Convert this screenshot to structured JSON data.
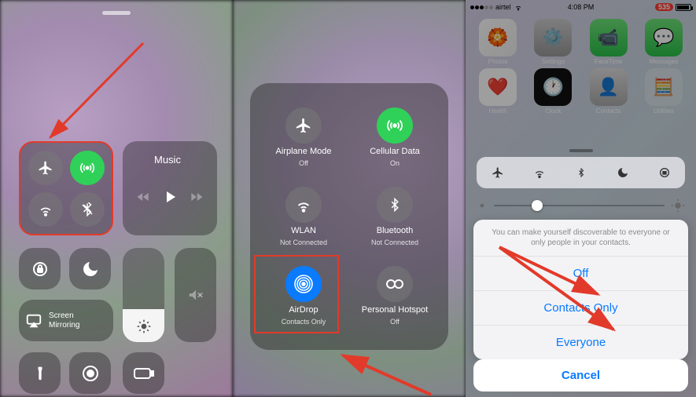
{
  "panel1": {
    "music_title": "Music",
    "mirror_label": "Screen\nMirroring"
  },
  "panel2": {
    "items": [
      {
        "label": "Airplane Mode",
        "sub": "Off"
      },
      {
        "label": "Cellular Data",
        "sub": "On"
      },
      {
        "label": "WLAN",
        "sub": "Not Connected"
      },
      {
        "label": "Bluetooth",
        "sub": "Not Connected"
      },
      {
        "label": "AirDrop",
        "sub": "Contacts Only"
      },
      {
        "label": "Personal Hotspot",
        "sub": "Off"
      }
    ]
  },
  "panel3": {
    "status": {
      "carrier": "airtel",
      "time": "4:08 PM",
      "badge": "535"
    },
    "apps_row1": [
      "Photos",
      "Settings",
      "FaceTime",
      "Messages"
    ],
    "apps_row2": [
      "Health",
      "Clock",
      "Contacts",
      "Utilities"
    ],
    "sheet": {
      "message": "You can make yourself discoverable to everyone or only people in your contacts.",
      "opt_off": "Off",
      "opt_contacts": "Contacts Only",
      "opt_everyone": "Everyone",
      "cancel": "Cancel"
    }
  }
}
